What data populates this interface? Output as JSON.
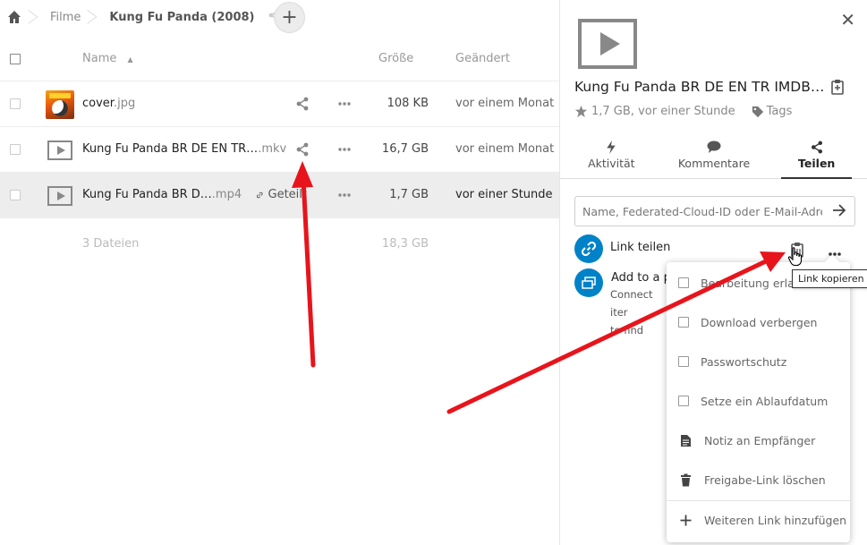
{
  "breadcrumb": {
    "home_icon": "home-icon",
    "items": [
      "Filme",
      "Kung Fu Panda (2008)"
    ],
    "add_label": "+"
  },
  "file_list": {
    "header": {
      "name": "Name",
      "size": "Größe",
      "modified": "Geändert"
    },
    "rows": [
      {
        "name": "cover",
        "ext": ".jpg",
        "size": "108 KB",
        "modified": "vor einem Monat",
        "thumb": "cover-image"
      },
      {
        "name": "Kung Fu Panda BR DE EN TR…",
        "ext": ".mkv",
        "size": "16,7 GB",
        "modified": "vor einem Monat",
        "thumb": "video-icon"
      },
      {
        "name": "Kung Fu Panda BR D…",
        "ext": ".mp4",
        "size": "1,7 GB",
        "modified": "vor einer Stunde",
        "thumb": "video-icon",
        "shared_label": "Geteilt"
      }
    ],
    "summary": {
      "count": "3 Dateien",
      "total": "18,3 GB"
    }
  },
  "sidebar": {
    "close": "✕",
    "title": "Kung Fu Panda BR DE EN TR IMDB…",
    "meta": "1,7 GB, vor einer Stunde",
    "tags": "Tags",
    "tabs": [
      {
        "label": "Aktivität",
        "icon": "flash-icon"
      },
      {
        "label": "Kommentare",
        "icon": "comment-icon"
      },
      {
        "label": "Teilen",
        "icon": "share-icon"
      }
    ],
    "share_input_placeholder": "Name, Federated-Cloud-ID oder E-Mail-Adre…",
    "link_share_label": "Link teilen",
    "tooltip": "Link kopieren",
    "project_title": "Add to a pr",
    "project_desc_1": "Connect iter",
    "project_desc_2": "to find"
  },
  "share_menu": {
    "items": [
      {
        "label": "Bearbeitung erlauben",
        "type": "checkbox"
      },
      {
        "label": "Download verbergen",
        "type": "checkbox"
      },
      {
        "label": "Passwortschutz",
        "type": "checkbox"
      },
      {
        "label": "Setze ein Ablaufdatum",
        "type": "checkbox"
      },
      {
        "label": "Notiz an Empfänger",
        "type": "icon",
        "icon": "note-icon"
      },
      {
        "label": "Freigabe-Link löschen",
        "type": "icon",
        "icon": "trash-icon"
      },
      {
        "label": "Weiteren Link hinzufügen",
        "type": "icon",
        "icon": "plus-icon"
      }
    ]
  },
  "colors": {
    "accent": "#0082c9",
    "annotation": "#e8141b",
    "active_row": "#ededed"
  }
}
